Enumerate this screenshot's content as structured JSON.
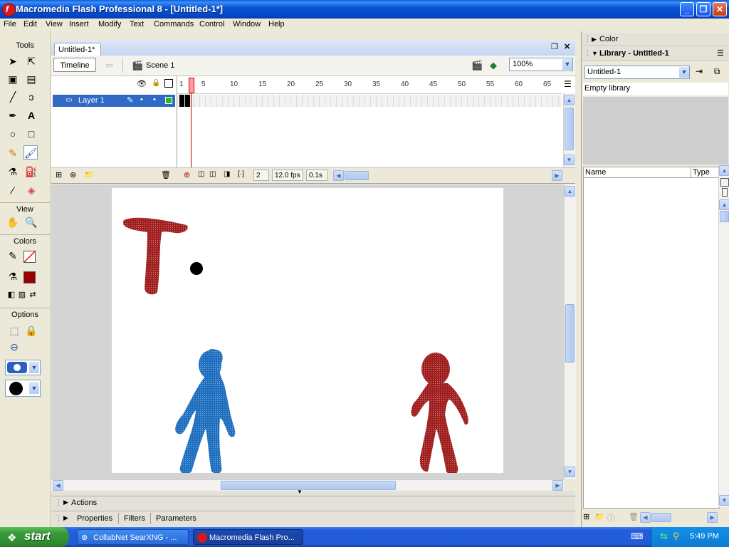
{
  "window": {
    "title": "Macromedia Flash Professional 8 - [Untitled-1*]",
    "app_icon_letter": "f",
    "controls": {
      "minimize": "_",
      "maximize": "❐",
      "close": "✕"
    }
  },
  "menubar": [
    "File",
    "Edit",
    "View",
    "Insert",
    "Modify",
    "Text",
    "Commands",
    "Control",
    "Window",
    "Help"
  ],
  "tools": {
    "header": "Tools",
    "view_header": "View",
    "colors_header": "Colors",
    "options_header": "Options",
    "stroke_color": "#ff0000",
    "fill_color": "#990000"
  },
  "document": {
    "tab_label": "Untitled-1*",
    "tab_controls": {
      "restore": "❐",
      "close": "✕"
    },
    "timeline_button": "Timeline",
    "scene_label": "Scene 1",
    "zoom": "100%"
  },
  "timeline": {
    "layer_name": "Layer 1",
    "frame_numbers": [
      "1",
      "5",
      "10",
      "15",
      "20",
      "25",
      "30",
      "35",
      "40",
      "45",
      "50",
      "55",
      "60",
      "65"
    ],
    "current_frame": "2",
    "fps": "12.0 fps",
    "elapsed": "0.1s"
  },
  "stage": {
    "background": "#ffffff",
    "shapes": {
      "t_color": "#a01e1e",
      "dot_color": "#000000",
      "blue_figure_color": "#1f6fc0",
      "red_figure_color": "#a01e1e"
    }
  },
  "panels": {
    "actions_label": "Actions",
    "tabs": [
      "Properties",
      "Filters",
      "Parameters"
    ]
  },
  "right_panel": {
    "color_header": "Color",
    "library_header": "Library - Untitled-1",
    "library_select": "Untitled-1",
    "empty_text": "Empty library",
    "columns": [
      "Name",
      "Type"
    ]
  },
  "taskbar": {
    "start_label": "start",
    "tasks": [
      "CollabNet SearXNG - ...",
      "Macromedia Flash Pro..."
    ],
    "clock": "5:49 PM"
  }
}
